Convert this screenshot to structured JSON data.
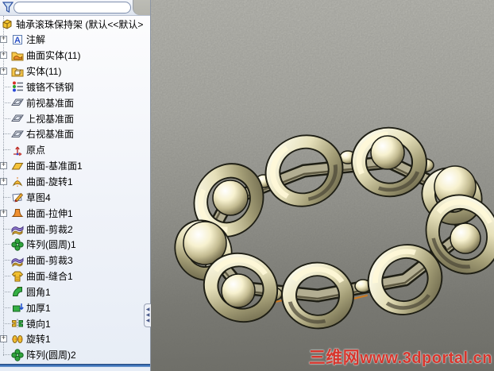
{
  "app": {
    "name": "SolidWorks FeatureManager"
  },
  "feature_tree": {
    "filter": {
      "placeholder": "",
      "value": ""
    },
    "root": {
      "label": "轴承滚珠保持架  (默认<<默认>",
      "icon": "part-icon"
    },
    "items": [
      {
        "label": "注解",
        "icon": "annotations-icon",
        "expandable": true
      },
      {
        "label": "曲面实体(11)",
        "icon": "surface-bodies-folder-icon",
        "expandable": true
      },
      {
        "label": "实体(11)",
        "icon": "solid-bodies-folder-icon",
        "expandable": true
      },
      {
        "label": "镀铬不锈钢",
        "icon": "material-icon",
        "expandable": false
      },
      {
        "label": "前视基准面",
        "icon": "plane-icon",
        "expandable": false
      },
      {
        "label": "上视基准面",
        "icon": "plane-icon",
        "expandable": false
      },
      {
        "label": "右视基准面",
        "icon": "plane-icon",
        "expandable": false
      },
      {
        "label": "原点",
        "icon": "origin-icon",
        "expandable": false
      },
      {
        "label": "曲面-基准面1",
        "icon": "surface-plane-icon",
        "expandable": true
      },
      {
        "label": "曲面-旋转1",
        "icon": "surface-revolve-icon",
        "expandable": true
      },
      {
        "label": "草图4",
        "icon": "sketch-icon",
        "expandable": false
      },
      {
        "label": "曲面-拉伸1",
        "icon": "surface-extrude-icon",
        "expandable": true
      },
      {
        "label": "曲面-剪裁2",
        "icon": "surface-trim-icon",
        "expandable": false
      },
      {
        "label": "阵列(圆周)1",
        "icon": "circular-pattern-icon",
        "expandable": false
      },
      {
        "label": "曲面-剪裁3",
        "icon": "surface-trim-icon",
        "expandable": false
      },
      {
        "label": "曲面-缝合1",
        "icon": "surface-knit-icon",
        "expandable": false
      },
      {
        "label": "圆角1",
        "icon": "fillet-icon",
        "expandable": false
      },
      {
        "label": "加厚1",
        "icon": "thicken-icon",
        "expandable": false
      },
      {
        "label": "镜向1",
        "icon": "mirror-icon",
        "expandable": false
      },
      {
        "label": "旋转1",
        "icon": "revolve-icon",
        "expandable": true
      },
      {
        "label": "阵列(圆周)2",
        "icon": "circular-pattern-icon",
        "expandable": false
      }
    ]
  },
  "viewport": {
    "model_name": "轴承滚珠保持架",
    "watermark": {
      "site_name": "三维网",
      "site_url": "www.3dportal.cn",
      "color": "#d6352c"
    }
  },
  "colors": {
    "rollback_bar": "#3f72b8",
    "viewport_top": "#c1c1ba",
    "viewport_bottom": "#6e6e67",
    "model_highlight": "#fffbe4",
    "model_mid": "#b0ab8d",
    "model_shadow": "#565138",
    "accent_edge_orange": "#cf7a20"
  }
}
